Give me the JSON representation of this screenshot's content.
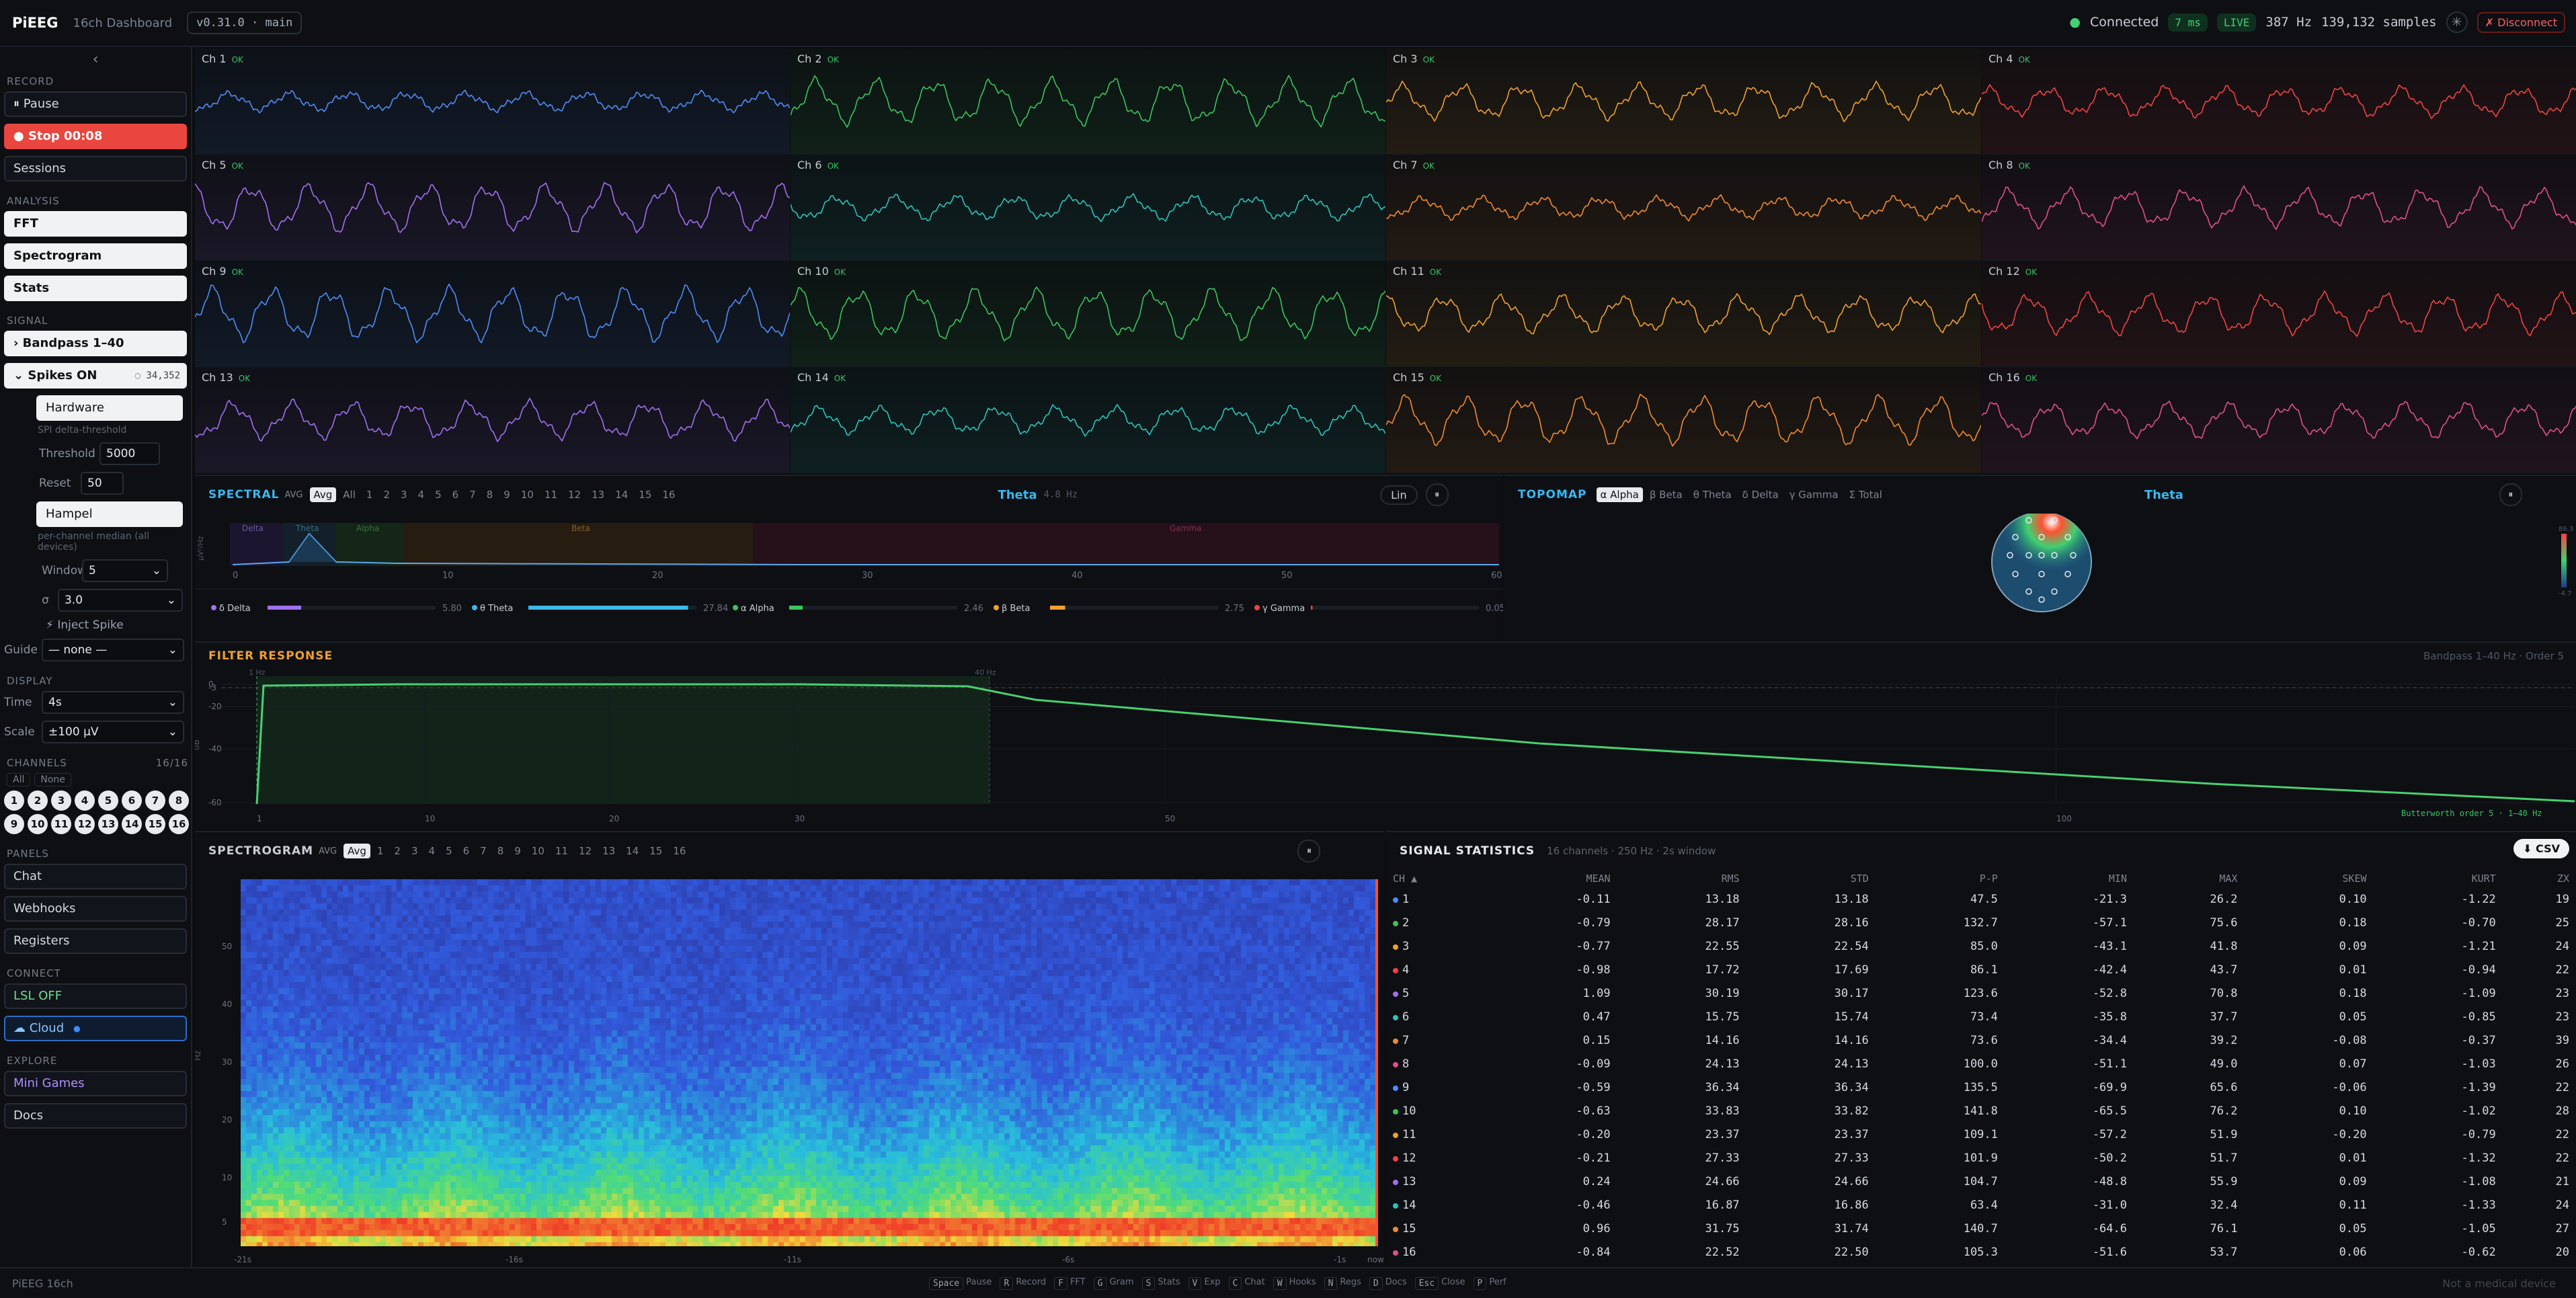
{
  "app": {
    "logo": "PiEEG",
    "subtitle": "16ch Dashboard",
    "version": "v0.31.0 · main"
  },
  "status": {
    "connected": "Connected",
    "latency": "7 ms",
    "live": "LIVE",
    "rate": "387 Hz",
    "samples": "139,132 samples",
    "disconnect": "✗ Disconnect"
  },
  "sidebar": {
    "collapse": "‹",
    "record_h": "RECORD",
    "pause": "⏸ Pause",
    "stop": "● Stop 00:08",
    "sessions": "Sessions",
    "analysis_h": "ANALYSIS",
    "fft": "FFT",
    "spectrogram": "Spectrogram",
    "stats": "Stats",
    "signal_h": "SIGNAL",
    "bandpass": "›  Bandpass 1–40",
    "spikes": "⌄  Spikes ON",
    "spikes_count": "◌ 34,352",
    "hardware": "Hardware",
    "spi_note": "SPI delta-threshold",
    "threshold_l": "Threshold",
    "threshold_v": "5000",
    "reset_l": "Reset",
    "reset_v": "50",
    "hampel": "Hampel",
    "hampel_note": "per-channel median (all devices)",
    "window_l": "Window",
    "window_v": "5",
    "sigma_l": "σ",
    "sigma_v": "3.0",
    "inject": "⚡ Inject Spike",
    "guide_l": "Guide",
    "guide_v": "— none —",
    "display_h": "DISPLAY",
    "time_l": "Time",
    "time_v": "4s",
    "scale_l": "Scale",
    "scale_v": "±100 µV",
    "channels_h": "CHANNELS",
    "channels_count": "16/16",
    "all": "All",
    "none": "None",
    "chs": [
      "1",
      "2",
      "3",
      "4",
      "5",
      "6",
      "7",
      "8",
      "9",
      "10",
      "11",
      "12",
      "13",
      "14",
      "15",
      "16"
    ],
    "panels_h": "PANELS",
    "chat": "Chat",
    "webhooks": "Webhooks",
    "registers": "Registers",
    "connect_h": "CONNECT",
    "lsl": "LSL OFF",
    "cloud": "☁ Cloud",
    "explore_h": "EXPLORE",
    "games": "Mini Games",
    "docs": "Docs"
  },
  "channels": [
    {
      "name": "Ch 1",
      "ok": "OK",
      "color": "#4f8df5"
    },
    {
      "name": "Ch 2",
      "ok": "OK",
      "color": "#3ac45f"
    },
    {
      "name": "Ch 3",
      "ok": "OK",
      "color": "#f0a030"
    },
    {
      "name": "Ch 4",
      "ok": "OK",
      "color": "#ef4444"
    },
    {
      "name": "Ch 5",
      "ok": "OK",
      "color": "#a070f0"
    },
    {
      "name": "Ch 6",
      "ok": "OK",
      "color": "#2cc4b8"
    },
    {
      "name": "Ch 7",
      "ok": "OK",
      "color": "#f08a30"
    },
    {
      "name": "Ch 8",
      "ok": "OK",
      "color": "#e0508a"
    },
    {
      "name": "Ch 9",
      "ok": "OK",
      "color": "#4f8df5"
    },
    {
      "name": "Ch 10",
      "ok": "OK",
      "color": "#3ac45f"
    },
    {
      "name": "Ch 11",
      "ok": "OK",
      "color": "#f0a030"
    },
    {
      "name": "Ch 12",
      "ok": "OK",
      "color": "#ef4444"
    },
    {
      "name": "Ch 13",
      "ok": "OK",
      "color": "#a070f0"
    },
    {
      "name": "Ch 14",
      "ok": "OK",
      "color": "#2cc4b8"
    },
    {
      "name": "Ch 15",
      "ok": "OK",
      "color": "#f08a30"
    },
    {
      "name": "Ch 16",
      "ok": "OK",
      "color": "#e0508a"
    }
  ],
  "spectral": {
    "title": "SPECTRAL",
    "avg": "AVG",
    "tabs": [
      "Avg",
      "All",
      "1",
      "2",
      "3",
      "4",
      "5",
      "6",
      "7",
      "8",
      "9",
      "10",
      "11",
      "12",
      "13",
      "14",
      "15",
      "16"
    ],
    "peak": "Theta",
    "peak_freq": "4.8 Hz",
    "lin": "Lin",
    "pause": "⏸",
    "ylabel": "µV²/Hz",
    "xticks": [
      "0",
      "10",
      "20",
      "30",
      "40",
      "50",
      "60 Hz"
    ],
    "band_labels": [
      "Delta",
      "Theta",
      "Alpha",
      "Beta",
      "Gamma"
    ],
    "bands": [
      {
        "name": "δ Delta",
        "value": "5.80",
        "color": "#a070f0",
        "frac": 0.2
      },
      {
        "name": "θ Theta",
        "value": "27.84",
        "color": "#3ab8e8",
        "frac": 0.95
      },
      {
        "name": "α Alpha",
        "value": "2.46",
        "color": "#3ac45f",
        "frac": 0.08
      },
      {
        "name": "β Beta",
        "value": "2.75",
        "color": "#f0a030",
        "frac": 0.09
      },
      {
        "name": "γ Gamma",
        "value": "0.05",
        "color": "#ef4444",
        "frac": 0.01
      }
    ]
  },
  "topomap": {
    "title": "TOPOMAP",
    "tabs": [
      "α Alpha",
      "β Beta",
      "θ Theta",
      "δ Delta",
      "γ Gamma",
      "Σ Total"
    ],
    "peak": "Theta",
    "pause": "⏸",
    "scale_max": "86.3",
    "scale_min": "-4.7"
  },
  "filter": {
    "title": "FILTER RESPONSE",
    "info": "Bandpass 1–40 Hz · Order 5",
    "low": "1 Hz",
    "high": "40 Hz",
    "ylabel": "dB",
    "yticks": [
      "0",
      "-3",
      "-20",
      "-40",
      "-60"
    ],
    "xticks": [
      "1",
      "10",
      "20",
      "30",
      "50",
      "100"
    ],
    "legend": "Butterworth order 5 · 1–40 Hz"
  },
  "spectrogram": {
    "title": "SPECTROGRAM",
    "avg": "AVG",
    "tabs": [
      "Avg",
      "1",
      "2",
      "3",
      "4",
      "5",
      "6",
      "7",
      "8",
      "9",
      "10",
      "11",
      "12",
      "13",
      "14",
      "15",
      "16"
    ],
    "pause": "⏸",
    "ylabel": "Hz",
    "yticks": [
      "50",
      "40",
      "30",
      "20",
      "10",
      "5"
    ],
    "xticks": [
      "-21s",
      "-16s",
      "-11s",
      "-6s",
      "-1s",
      "now"
    ]
  },
  "stats": {
    "title": "SIGNAL STATISTICS",
    "info": "16 channels · 250 Hz · 2s window",
    "csv": "⬇ CSV",
    "cols": [
      "CH ▲",
      "MEAN",
      "RMS",
      "STD",
      "P-P",
      "MIN",
      "MAX",
      "SKEW",
      "KURT",
      "ZX"
    ],
    "rows": [
      [
        "1",
        "-0.11",
        "13.18",
        "13.18",
        "47.5",
        "-21.3",
        "26.2",
        "0.10",
        "-1.22",
        "19"
      ],
      [
        "2",
        "-0.79",
        "28.17",
        "28.16",
        "132.7",
        "-57.1",
        "75.6",
        "0.18",
        "-0.70",
        "25"
      ],
      [
        "3",
        "-0.77",
        "22.55",
        "22.54",
        "85.0",
        "-43.1",
        "41.8",
        "0.09",
        "-1.21",
        "24"
      ],
      [
        "4",
        "-0.98",
        "17.72",
        "17.69",
        "86.1",
        "-42.4",
        "43.7",
        "0.01",
        "-0.94",
        "22"
      ],
      [
        "5",
        "1.09",
        "30.19",
        "30.17",
        "123.6",
        "-52.8",
        "70.8",
        "0.18",
        "-1.09",
        "23"
      ],
      [
        "6",
        "0.47",
        "15.75",
        "15.74",
        "73.4",
        "-35.8",
        "37.7",
        "0.05",
        "-0.85",
        "23"
      ],
      [
        "7",
        "0.15",
        "14.16",
        "14.16",
        "73.6",
        "-34.4",
        "39.2",
        "-0.08",
        "-0.37",
        "39"
      ],
      [
        "8",
        "-0.09",
        "24.13",
        "24.13",
        "100.0",
        "-51.1",
        "49.0",
        "0.07",
        "-1.03",
        "26"
      ],
      [
        "9",
        "-0.59",
        "36.34",
        "36.34",
        "135.5",
        "-69.9",
        "65.6",
        "-0.06",
        "-1.39",
        "22"
      ],
      [
        "10",
        "-0.63",
        "33.83",
        "33.82",
        "141.8",
        "-65.5",
        "76.2",
        "0.10",
        "-1.02",
        "28"
      ],
      [
        "11",
        "-0.20",
        "23.37",
        "23.37",
        "109.1",
        "-57.2",
        "51.9",
        "-0.20",
        "-0.79",
        "22"
      ],
      [
        "12",
        "-0.21",
        "27.33",
        "27.33",
        "101.9",
        "-50.2",
        "51.7",
        "0.01",
        "-1.32",
        "22"
      ],
      [
        "13",
        "0.24",
        "24.66",
        "24.66",
        "104.7",
        "-48.8",
        "55.9",
        "0.09",
        "-1.08",
        "21"
      ],
      [
        "14",
        "-0.46",
        "16.87",
        "16.86",
        "63.4",
        "-31.0",
        "32.4",
        "0.11",
        "-1.33",
        "24"
      ],
      [
        "15",
        "0.96",
        "31.75",
        "31.74",
        "140.7",
        "-64.6",
        "76.1",
        "0.05",
        "-1.05",
        "27"
      ],
      [
        "16",
        "-0.84",
        "22.52",
        "22.50",
        "105.3",
        "-51.6",
        "53.7",
        "0.06",
        "-0.62",
        "20"
      ]
    ]
  },
  "footer": {
    "left": "PiEEG 16ch",
    "keys": [
      [
        "Space",
        "Pause"
      ],
      [
        "R",
        "Record"
      ],
      [
        "F",
        "FFT"
      ],
      [
        "G",
        "Gram"
      ],
      [
        "S",
        "Stats"
      ],
      [
        "V",
        "Exp"
      ],
      [
        "C",
        "Chat"
      ],
      [
        "W",
        "Hooks"
      ],
      [
        "N",
        "Regs"
      ],
      [
        "D",
        "Docs"
      ],
      [
        "Esc",
        "Close"
      ],
      [
        "P",
        "Perf"
      ]
    ],
    "right": "Not a medical device"
  }
}
